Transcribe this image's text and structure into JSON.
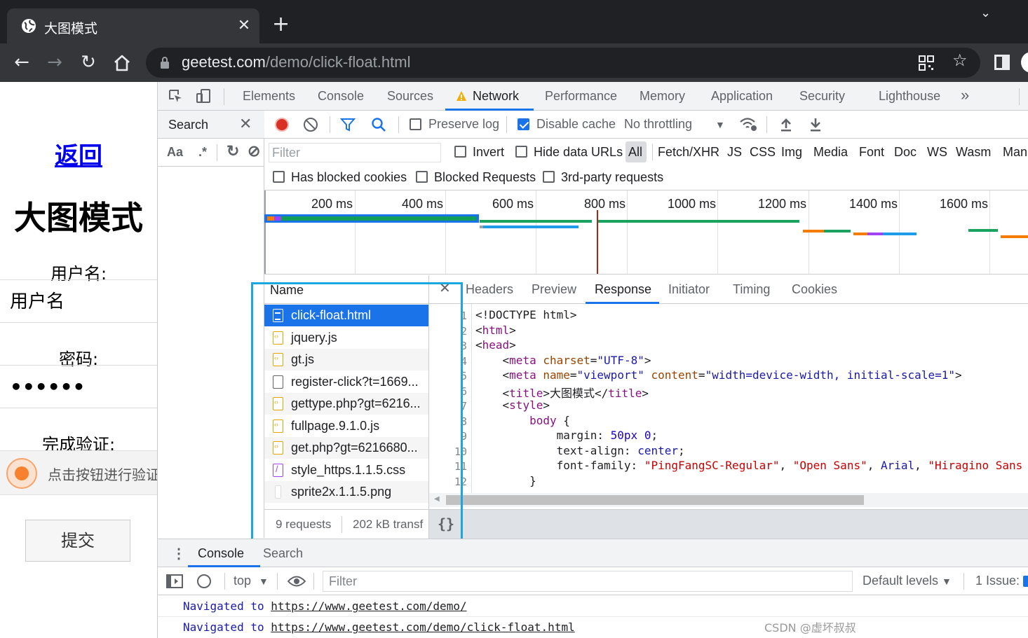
{
  "browser": {
    "tab_title": "大图模式",
    "url_host": "geetest.com",
    "url_path": "/demo/click-float.html",
    "new_tab_symbol": "+",
    "tab_close_symbol": "✕",
    "tab_menu_symbol": "⌄"
  },
  "page": {
    "back_link": "返回",
    "title": "大图模式",
    "username_label": "用户名:",
    "username_placeholder": "用户名",
    "password_label": "密码:",
    "password_value": "••••••",
    "captcha_label": "完成验证:",
    "captcha_text": "点击按钮进行验证",
    "submit_label": "提交"
  },
  "devtools": {
    "tabs": [
      "Elements",
      "Console",
      "Sources",
      "Network",
      "Performance",
      "Memory",
      "Application",
      "Security",
      "Lighthouse"
    ],
    "more_tabs": "»",
    "search_label": "Search",
    "search_opts": [
      "Aa",
      ".*"
    ],
    "toolbar": {
      "preserve_log": "Preserve log",
      "disable_cache": "Disable cache",
      "throttling": "No throttling"
    },
    "filter": {
      "placeholder": "Filter",
      "invert": "Invert",
      "hide_data_urls": "Hide data URLs",
      "types": [
        "All",
        "Fetch/XHR",
        "JS",
        "CSS",
        "Img",
        "Media",
        "Font",
        "Doc",
        "WS",
        "Wasm",
        "Mani"
      ],
      "has_blocked_cookies": "Has blocked cookies",
      "blocked_requests": "Blocked Requests",
      "third_party": "3rd-party requests"
    },
    "timeline_ticks": [
      "200 ms",
      "400 ms",
      "600 ms",
      "800 ms",
      "1000 ms",
      "1200 ms",
      "1400 ms",
      "1600 ms"
    ],
    "requests": {
      "header": "Name",
      "items": [
        "click-float.html",
        "jquery.js",
        "gt.js",
        "register-click?t=1669...",
        "gettype.php?gt=6216...",
        "fullpage.9.1.0.js",
        "get.php?gt=6216680...",
        "style_https.1.1.5.css",
        "sprite2x.1.1.5.png"
      ],
      "footer_count": "9 requests",
      "footer_transfer": "202 kB transf"
    },
    "detail_tabs": [
      "Headers",
      "Preview",
      "Response",
      "Initiator",
      "Timing",
      "Cookies"
    ],
    "pretty_print": "{}",
    "code": {
      "line_numbers": [
        "1",
        "2",
        "3",
        "4",
        "5",
        "6",
        "7",
        "8",
        "9",
        "10",
        "11",
        "12"
      ]
    },
    "drawer": {
      "tabs": [
        "Console",
        "Search"
      ],
      "context": "top",
      "filter_placeholder": "Filter",
      "levels": "Default levels",
      "issues": "1 Issue:",
      "logs": [
        {
          "prefix": "Navigated to ",
          "url": "https://www.geetest.com/demo/"
        },
        {
          "prefix": "Navigated to ",
          "url": "https://www.geetest.com/demo/click-float.html"
        }
      ]
    }
  },
  "watermark": "CSDN @虚坏叔叔",
  "colors": {
    "accent": "#1a73e8",
    "record": "#d93025",
    "highlight": "#1aa7e0",
    "link": "#0000ee"
  }
}
